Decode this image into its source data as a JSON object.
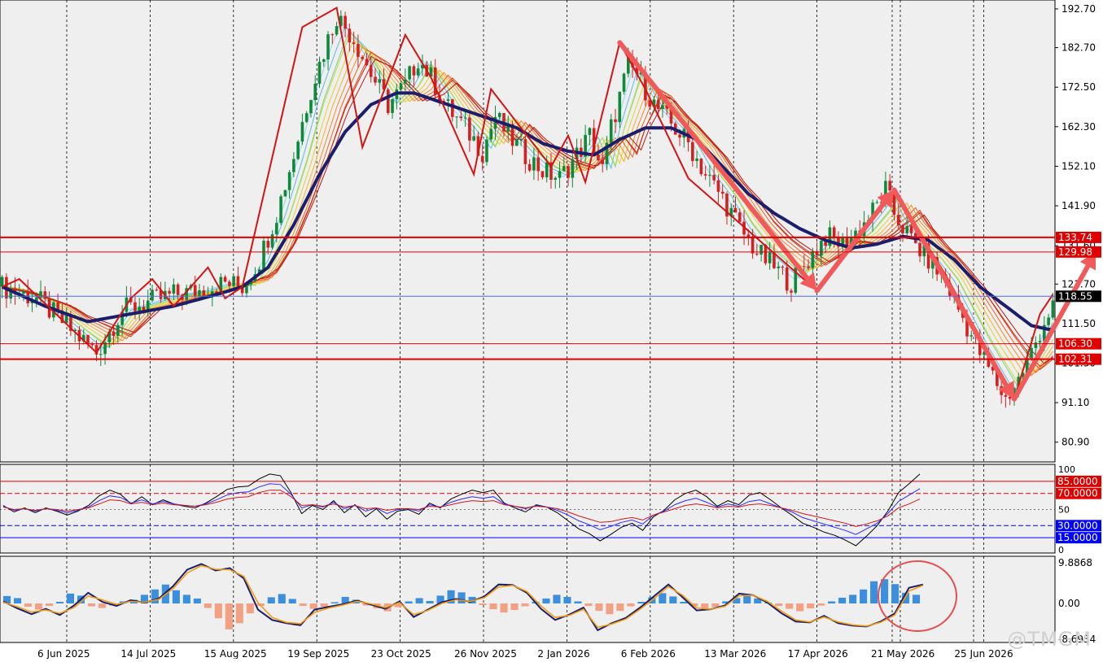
{
  "colors": {
    "background": "#efefef",
    "grid": "#000000",
    "candle_up": "#0c8a3a",
    "candle_down": "#d61f1f",
    "ma_thick": "#1b1e6b",
    "zigzag": "#d21414",
    "arrows": "#f05a5a",
    "level_line": "#e00000",
    "price_tag": "#e00000",
    "current_tag": "#000000",
    "current_line": "#4a6ed8",
    "rsi_fast": "#000000",
    "rsi_mid": "#2a2aff",
    "rsi_slow": "#d01818",
    "macd_hist_pos": "#3b8fdc",
    "macd_hist_neg": "#f3a184",
    "macd_line": "#1b1e6b",
    "signal_line": "#f39c12",
    "circle": "#e45050"
  },
  "watermark": "@TMGM",
  "chart_data": [
    {
      "type": "candlestick",
      "panel": "price",
      "ylim": [
        75.8,
        195.0
      ],
      "y_ticks": [
        "192.70",
        "182.70",
        "172.50",
        "162.30",
        "152.10",
        "141.90",
        "131.60",
        "121.70",
        "111.50",
        "101.30",
        "91.10",
        "80.90"
      ],
      "x_ticks": [
        "6 Jun 2025",
        "14 Jul 2025",
        "15 Aug 2025",
        "19 Sep 2025",
        "23 Oct 2025",
        "26 Nov 2025",
        "2 Jan 2026",
        "6 Feb 2026",
        "13 Mar 2026",
        "17 Apr 2026",
        "21 May 2026",
        "25 Jun 2026"
      ],
      "price_path": [
        [
          0,
          121
        ],
        [
          8,
          118
        ],
        [
          14,
          112
        ],
        [
          18,
          108
        ],
        [
          22,
          104
        ],
        [
          28,
          115
        ],
        [
          34,
          117
        ],
        [
          40,
          119
        ],
        [
          46,
          120
        ],
        [
          52,
          122
        ],
        [
          56,
          121
        ],
        [
          60,
          128
        ],
        [
          64,
          140
        ],
        [
          68,
          155
        ],
        [
          72,
          172
        ],
        [
          76,
          185
        ],
        [
          78,
          191
        ],
        [
          82,
          185
        ],
        [
          86,
          176
        ],
        [
          90,
          168
        ],
        [
          94,
          173
        ],
        [
          97,
          180
        ],
        [
          100,
          175
        ],
        [
          104,
          167
        ],
        [
          108,
          162
        ],
        [
          112,
          156
        ],
        [
          115,
          165
        ],
        [
          118,
          160
        ],
        [
          122,
          155
        ],
        [
          126,
          151
        ],
        [
          130,
          149
        ],
        [
          134,
          155
        ],
        [
          137,
          160
        ],
        [
          140,
          151
        ],
        [
          142,
          162
        ],
        [
          144,
          170
        ],
        [
          146,
          178
        ],
        [
          148,
          176
        ],
        [
          152,
          168
        ],
        [
          156,
          163
        ],
        [
          160,
          158
        ],
        [
          164,
          150
        ],
        [
          168,
          144
        ],
        [
          172,
          136
        ],
        [
          176,
          130
        ],
        [
          180,
          126
        ],
        [
          184,
          122
        ],
        [
          188,
          128
        ],
        [
          192,
          134
        ],
        [
          196,
          132
        ],
        [
          200,
          136
        ],
        [
          204,
          142
        ],
        [
          206,
          146
        ],
        [
          208,
          140
        ],
        [
          212,
          133
        ],
        [
          216,
          128
        ],
        [
          220,
          122
        ],
        [
          224,
          113
        ],
        [
          228,
          104
        ],
        [
          232,
          96
        ],
        [
          234,
          92
        ],
        [
          237,
          97
        ],
        [
          240,
          104
        ],
        [
          243,
          112
        ],
        [
          246,
          118
        ]
      ],
      "ma_thick": [
        [
          0,
          121
        ],
        [
          10,
          116
        ],
        [
          20,
          112
        ],
        [
          30,
          114
        ],
        [
          40,
          116
        ],
        [
          50,
          119
        ],
        [
          56,
          121
        ],
        [
          62,
          126
        ],
        [
          68,
          137
        ],
        [
          74,
          150
        ],
        [
          80,
          161
        ],
        [
          86,
          168
        ],
        [
          92,
          171
        ],
        [
          96,
          171
        ],
        [
          104,
          168
        ],
        [
          112,
          165
        ],
        [
          120,
          162
        ],
        [
          126,
          158
        ],
        [
          132,
          156
        ],
        [
          138,
          155
        ],
        [
          144,
          159
        ],
        [
          150,
          162
        ],
        [
          156,
          162
        ],
        [
          162,
          159
        ],
        [
          168,
          152
        ],
        [
          174,
          145
        ],
        [
          180,
          140
        ],
        [
          186,
          136
        ],
        [
          192,
          133
        ],
        [
          198,
          131
        ],
        [
          204,
          132
        ],
        [
          210,
          134
        ],
        [
          216,
          133
        ],
        [
          222,
          128
        ],
        [
          228,
          121
        ],
        [
          234,
          116
        ],
        [
          240,
          111
        ],
        [
          244,
          110
        ],
        [
          246,
          110
        ]
      ],
      "zigzag": [
        [
          0,
          121
        ],
        [
          4,
          123
        ],
        [
          22,
          104
        ],
        [
          30,
          118
        ],
        [
          35,
          123
        ],
        [
          40,
          116
        ],
        [
          48,
          126
        ],
        [
          52,
          118
        ],
        [
          56,
          121
        ],
        [
          70,
          188
        ],
        [
          78,
          193
        ],
        [
          84,
          157
        ],
        [
          94,
          186
        ],
        [
          100,
          175
        ],
        [
          110,
          150
        ],
        [
          114,
          172
        ],
        [
          128,
          152
        ],
        [
          132,
          160
        ],
        [
          136,
          148
        ],
        [
          144,
          184
        ],
        [
          150,
          172
        ],
        [
          160,
          149
        ],
        [
          190,
          120
        ],
        [
          200,
          135
        ],
        [
          208,
          146
        ],
        [
          220,
          124
        ],
        [
          236,
          92
        ],
        [
          242,
          114
        ],
        [
          245,
          119
        ]
      ],
      "arrows": [
        {
          "from": [
            144,
            184
          ],
          "to": [
            190,
            120
          ]
        },
        {
          "from": [
            190,
            120
          ],
          "to": [
            208,
            146
          ]
        },
        {
          "from": [
            208,
            146
          ],
          "to": [
            236,
            92
          ]
        },
        {
          "from": [
            236,
            92
          ],
          "to": [
            255,
            130
          ]
        },
        {
          "from": [
            258,
            132
          ],
          "to": [
            265,
            119
          ]
        }
      ],
      "levels": [
        {
          "value": 133.74,
          "label": "133.74",
          "style": "solid"
        },
        {
          "value": 129.98,
          "label": "129.98",
          "style": "solid"
        },
        {
          "value": 106.3,
          "label": "106.30",
          "style": "solid"
        },
        {
          "value": 102.31,
          "label": "102.31",
          "style": "solid"
        }
      ],
      "current_price": {
        "value": 118.55,
        "label": "118.55"
      }
    },
    {
      "type": "line",
      "panel": "rsi",
      "ylim": [
        0,
        100
      ],
      "y_ticks": [
        "100",
        "50",
        "0"
      ],
      "levels": [
        {
          "value": 85,
          "label": "85.0000",
          "style": "solid",
          "color": "#e00000"
        },
        {
          "value": 70,
          "label": "70.0000",
          "style": "dashed",
          "color": "#e00000"
        },
        {
          "value": 30,
          "label": "30.0000",
          "style": "dashed",
          "color": "#0000ff"
        },
        {
          "value": 15,
          "label": "15.0000",
          "style": "solid",
          "color": "#0000ff"
        }
      ],
      "series": [
        {
          "values": [
            55,
            47,
            52,
            46,
            52,
            48,
            43,
            48,
            55,
            67,
            74,
            69,
            57,
            66,
            56,
            62,
            57,
            54,
            52,
            58,
            66,
            75,
            78,
            79,
            88,
            94,
            92,
            71,
            45,
            55,
            50,
            61,
            46,
            56,
            41,
            51,
            38,
            48,
            50,
            44,
            58,
            52,
            63,
            69,
            74,
            71,
            74,
            58,
            52,
            47,
            56,
            53,
            46,
            36,
            26,
            20,
            11,
            19,
            28,
            33,
            24,
            41,
            49,
            62,
            70,
            74,
            66,
            54,
            61,
            56,
            68,
            71,
            62,
            52,
            43,
            33,
            28,
            22,
            18,
            12,
            5,
            17,
            30,
            48,
            71,
            82,
            94
          ]
        },
        {
          "values": [
            54,
            49,
            51,
            48,
            51,
            49,
            46,
            49,
            53,
            61,
            67,
            65,
            58,
            62,
            57,
            60,
            57,
            55,
            54,
            57,
            62,
            68,
            71,
            72,
            78,
            82,
            81,
            69,
            52,
            56,
            53,
            59,
            51,
            55,
            48,
            52,
            45,
            50,
            51,
            48,
            56,
            53,
            59,
            63,
            66,
            64,
            66,
            57,
            54,
            51,
            55,
            53,
            49,
            43,
            36,
            31,
            25,
            29,
            34,
            37,
            32,
            43,
            48,
            56,
            61,
            64,
            59,
            53,
            57,
            54,
            60,
            62,
            57,
            52,
            47,
            40,
            36,
            32,
            28,
            24,
            19,
            26,
            33,
            45,
            60,
            68,
            76
          ]
        },
        {
          "values": [
            53,
            50,
            51,
            49,
            51,
            50,
            48,
            50,
            52,
            57,
            62,
            61,
            57,
            59,
            56,
            58,
            56,
            55,
            54,
            56,
            59,
            63,
            65,
            66,
            71,
            74,
            74,
            66,
            55,
            56,
            54,
            57,
            53,
            55,
            51,
            52,
            49,
            51,
            51,
            50,
            54,
            53,
            56,
            59,
            61,
            60,
            61,
            56,
            54,
            52,
            54,
            53,
            51,
            47,
            42,
            38,
            34,
            35,
            38,
            40,
            37,
            43,
            47,
            51,
            55,
            57,
            55,
            52,
            54,
            53,
            56,
            57,
            55,
            52,
            49,
            45,
            42,
            39,
            36,
            33,
            29,
            32,
            36,
            42,
            52,
            57,
            63
          ]
        }
      ]
    },
    {
      "type": "bar",
      "panel": "macd",
      "ylim": [
        -8.6934,
        9.8868
      ],
      "y_ticks": [
        "9.8868",
        "0.00",
        "-8.6934"
      ],
      "histogram": [
        1.8,
        1.3,
        -0.8,
        -1.5,
        -0.6,
        0.4,
        2.4,
        1.9,
        -0.7,
        -1.1,
        -0.5,
        0.5,
        0.9,
        2.1,
        3.4,
        4.6,
        3.2,
        2.1,
        1.2,
        -1.1,
        -3.6,
        -6.3,
        -4.8,
        -2.4,
        -0.6,
        1.5,
        2.3,
        1.1,
        -0.6,
        -1.3,
        -0.8,
        0.3,
        1.6,
        0.9,
        -0.5,
        -1.2,
        -1.9,
        -0.9,
        0.5,
        1.3,
        0.6,
        1.9,
        3.2,
        2.7,
        1.6,
        -0.4,
        -1.4,
        -2.2,
        -1.6,
        -0.7,
        0.4,
        1.2,
        2.1,
        1.6,
        0.5,
        -0.6,
        -1.8,
        -2.6,
        -1.8,
        -0.7,
        0.4,
        1.5,
        2.5,
        1.7,
        0.4,
        -0.7,
        -1.5,
        -0.8,
        0.5,
        1.3,
        2.1,
        1.2,
        0.2,
        -0.6,
        -1.3,
        -1.9,
        -1.2,
        -0.5,
        0.5,
        1.4,
        2.1,
        3.4,
        5.4,
        5.9,
        4.7,
        2.6,
        2.1
      ],
      "macd": [
        0.5,
        -1.2,
        -2.6,
        -1.3,
        -2.8,
        -0.5,
        2.6,
        0.4,
        -0.6,
        0.8,
        0.2,
        1.2,
        4.2,
        8.2,
        9.6,
        8.0,
        8.6,
        6.1,
        -1.5,
        -4.0,
        -4.8,
        -5.3,
        -1.5,
        -0.8,
        -0.2,
        0.7,
        -0.3,
        -1.3,
        0.5,
        -3.3,
        -1.5,
        0.3,
        1.1,
        0.4,
        1.7,
        4.6,
        4.5,
        2.6,
        -1.3,
        -4.0,
        -2.7,
        -1.0,
        -6.5,
        -4.8,
        -3.5,
        -1.0,
        1.8,
        4.6,
        1.5,
        -1.7,
        -1.4,
        -0.5,
        2.4,
        2.0,
        0.2,
        -2.4,
        -4.4,
        -4.6,
        -3.0,
        -4.8,
        -5.4,
        -5.6,
        -4.4,
        -2.4,
        3.8,
        4.6
      ],
      "signal": [
        0.3,
        -0.8,
        -2.1,
        -1.6,
        -2.4,
        -1.0,
        1.8,
        0.9,
        -0.2,
        0.5,
        0.3,
        1.0,
        3.6,
        7.4,
        9.2,
        8.3,
        8.2,
        6.6,
        0.2,
        -3.4,
        -4.6,
        -4.9,
        -2.2,
        -1.1,
        -0.4,
        0.5,
        -0.1,
        -1.0,
        0.2,
        -2.7,
        -1.7,
        0.0,
        0.9,
        0.5,
        1.4,
        4.0,
        4.4,
        2.9,
        -0.6,
        -3.4,
        -2.9,
        -1.4,
        -5.8,
        -5.0,
        -3.8,
        -1.4,
        1.2,
        4.1,
        2.0,
        -1.1,
        -1.4,
        -0.7,
        1.9,
        2.0,
        0.5,
        -1.9,
        -4.0,
        -4.5,
        -3.3,
        -4.5,
        -5.2,
        -5.5,
        -4.6,
        -2.8,
        3.0,
        4.4
      ]
    }
  ]
}
